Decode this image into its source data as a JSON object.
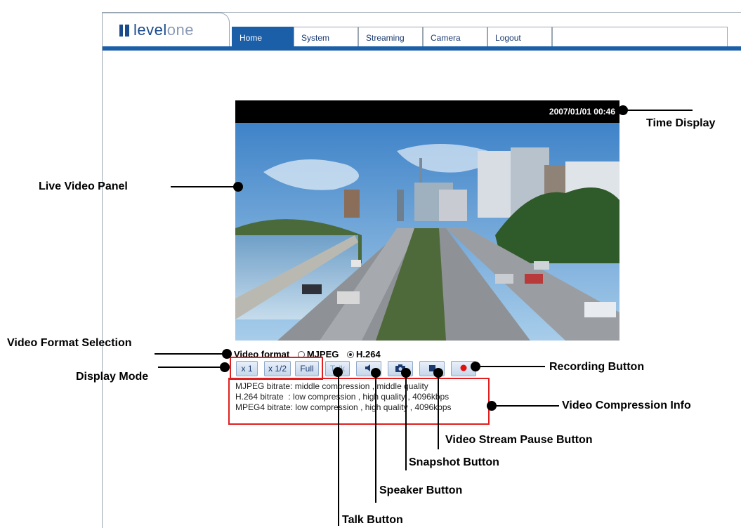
{
  "header": {
    "logo_main": "level",
    "logo_accent": "one",
    "nav": [
      "Home",
      "System",
      "Streaming",
      "Camera",
      "Logout"
    ],
    "active_tab": "Home"
  },
  "video": {
    "timestamp": "2007/01/01 00:46"
  },
  "format": {
    "label": "Video format",
    "options": [
      "MJPEG",
      "H.264"
    ],
    "selected": "H.264"
  },
  "display_mode": [
    "x 1",
    "x 1/2",
    "Full"
  ],
  "buttons": {
    "talk": "Talk",
    "speaker_icon": "speaker-icon",
    "snapshot_icon": "camera-icon",
    "pause_icon": "stop-square-icon",
    "record_icon": "record-dot-icon"
  },
  "info": {
    "mjpeg": "MJPEG bitrate: middle compression , middle quality",
    "h264": "H.264 bitrate  : low compression , high quality , 4096kbps",
    "mpeg4": "MPEG4 bitrate: low compression , high quality , 4096kbps"
  },
  "callouts": {
    "time_display": "Time Display",
    "live_video": "Live Video Panel",
    "format_selection": "Video Format Selection",
    "display_mode": "Display Mode",
    "recording": "Recording Button",
    "compression": "Video Compression Info",
    "pause": "Video Stream Pause Button",
    "snapshot": "Snapshot Button",
    "speaker": "Speaker Button",
    "talk": "Talk Button"
  },
  "colors": {
    "accent_blue": "#1a5fa8",
    "highlight_red": "#e02020",
    "record_red": "#e01010"
  }
}
